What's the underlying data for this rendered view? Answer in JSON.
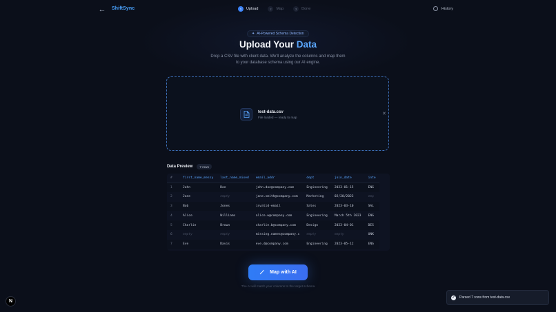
{
  "header": {
    "brand": "ShiftSync",
    "steps": [
      {
        "num": "1",
        "label": "Upload"
      },
      {
        "num": "2",
        "label": "Map"
      },
      {
        "num": "3",
        "label": "Done"
      }
    ],
    "history_label": "History"
  },
  "hero": {
    "badge": "AI-Powered Schema Detection",
    "title_main": "Upload Your ",
    "title_accent": "Data",
    "subtitle": "Drop a CSV file with client data. We'll analyze the columns and map them to your database schema using our AI engine."
  },
  "file": {
    "name": "test-data.csv",
    "status": "File loaded — ready to map"
  },
  "preview": {
    "title": "Data Preview",
    "rows_badge": "7 rows",
    "columns": [
      "#",
      "first_name_messy",
      "last_name_mixed",
      "email_addr",
      "dept",
      "join_date",
      "inte"
    ],
    "rows": [
      [
        "1",
        "John",
        "Doe",
        "john.doe@company.com",
        "Engineering",
        "2023-01-15",
        "ENG"
      ],
      [
        "2",
        "Jane",
        "empty",
        "jane.smith@company.com",
        "Marketing",
        "02/20/2023",
        "emp"
      ],
      [
        "3",
        "Bob",
        "Jones",
        "invalid-email",
        "Sales",
        "2023-03-10",
        "SAL"
      ],
      [
        "4",
        "Alice",
        "Williams",
        "alice.w@company.com",
        "Engineering",
        "March 5th 2023",
        "ENG"
      ],
      [
        "5",
        "Charlie",
        "Brown",
        "charlie.b@company.com",
        "Design",
        "2023-04-01",
        "DES"
      ],
      [
        "6",
        "empty",
        "empty",
        "missing.names@company.c",
        "empty",
        "empty",
        "UNK"
      ],
      [
        "7",
        "Eve",
        "Davis",
        "eve.d@company.com",
        "Engineering",
        "2023-05-12",
        "ENG"
      ]
    ]
  },
  "cta": {
    "label": "Map with AI",
    "note": "The AI will match your columns to the target schema"
  },
  "toast": {
    "message": "Parsed 7 rows from test-data.csv"
  },
  "corner_logo": "N"
}
